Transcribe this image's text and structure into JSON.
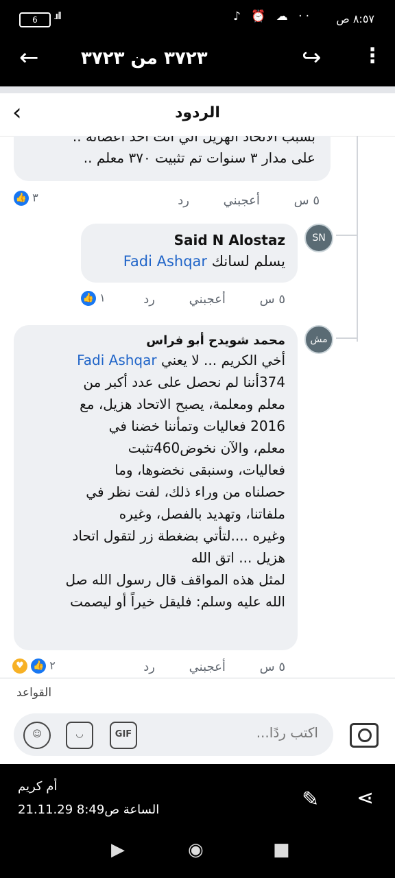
{
  "status_bar": {
    "time": "٨:٥٧ ص",
    "battery": "6",
    "signal": ".ııll",
    "icons": "♪ ⏰ ☁ ··"
  },
  "viewer": {
    "counter": "٣٧٢٣ من ٣٧٢٣",
    "sender": "أم كريم",
    "timestamp": "21.11.29 الساعة ص8:49"
  },
  "screenshot": {
    "header_title": "الردود",
    "rules_label": "القواعد",
    "composer_placeholder": "اكتب ردًا...",
    "gif_label": "GIF",
    "comments": [
      {
        "text_line1": "بسبب الاتحاد الهزيل الي انت احد اعضائه ..",
        "text_line2": "على مدار ٣ سنوات تم تثبيت ٣٧٠ معلم ..",
        "time": "٥ س",
        "like": "أعجبني",
        "reply": "رد",
        "reactions": "٣"
      },
      {
        "author": "Said N Alostaz",
        "text": "يسلم لسانك",
        "mention": "Fadi Ashqar",
        "time": "٥ س",
        "like": "أعجبني",
        "reply": "رد",
        "reactions": "١"
      },
      {
        "author": "محمد شويدح أبو فراس",
        "line1_prefix": "أخي الكريم ... لا يعني",
        "mention": "Fadi Ashqar",
        "lines": [
          "374أننا لم نحصل على عدد أكبر من",
          "معلم ومعلمة، يصبح الاتحاد هزيل، مع",
          "2016 فعاليات وتمأننا خضنا في",
          "معلم، والآن نخوض460تثبت",
          "فعاليات، وسنبقى نخضوها، وما",
          "حصلناه من وراء ذلك، لفت نظر في",
          "ملفاتنا، وتهديد بالفصل، وغيره",
          "وغيره ....لتأتي بضغطة زر لتقول اتحاد",
          "هزيل ... اتق الله",
          "لمثل هذه المواقف قال رسول الله صل",
          "الله عليه وسلم: فليقل خيراً أو ليصمت"
        ],
        "time": "٥ س",
        "like": "أعجبني",
        "reply": "رد",
        "reactions": "٢"
      }
    ]
  },
  "colors": {
    "link": "#1f64c8",
    "like_blue": "#1877f2",
    "bubble": "#eef0f3"
  }
}
